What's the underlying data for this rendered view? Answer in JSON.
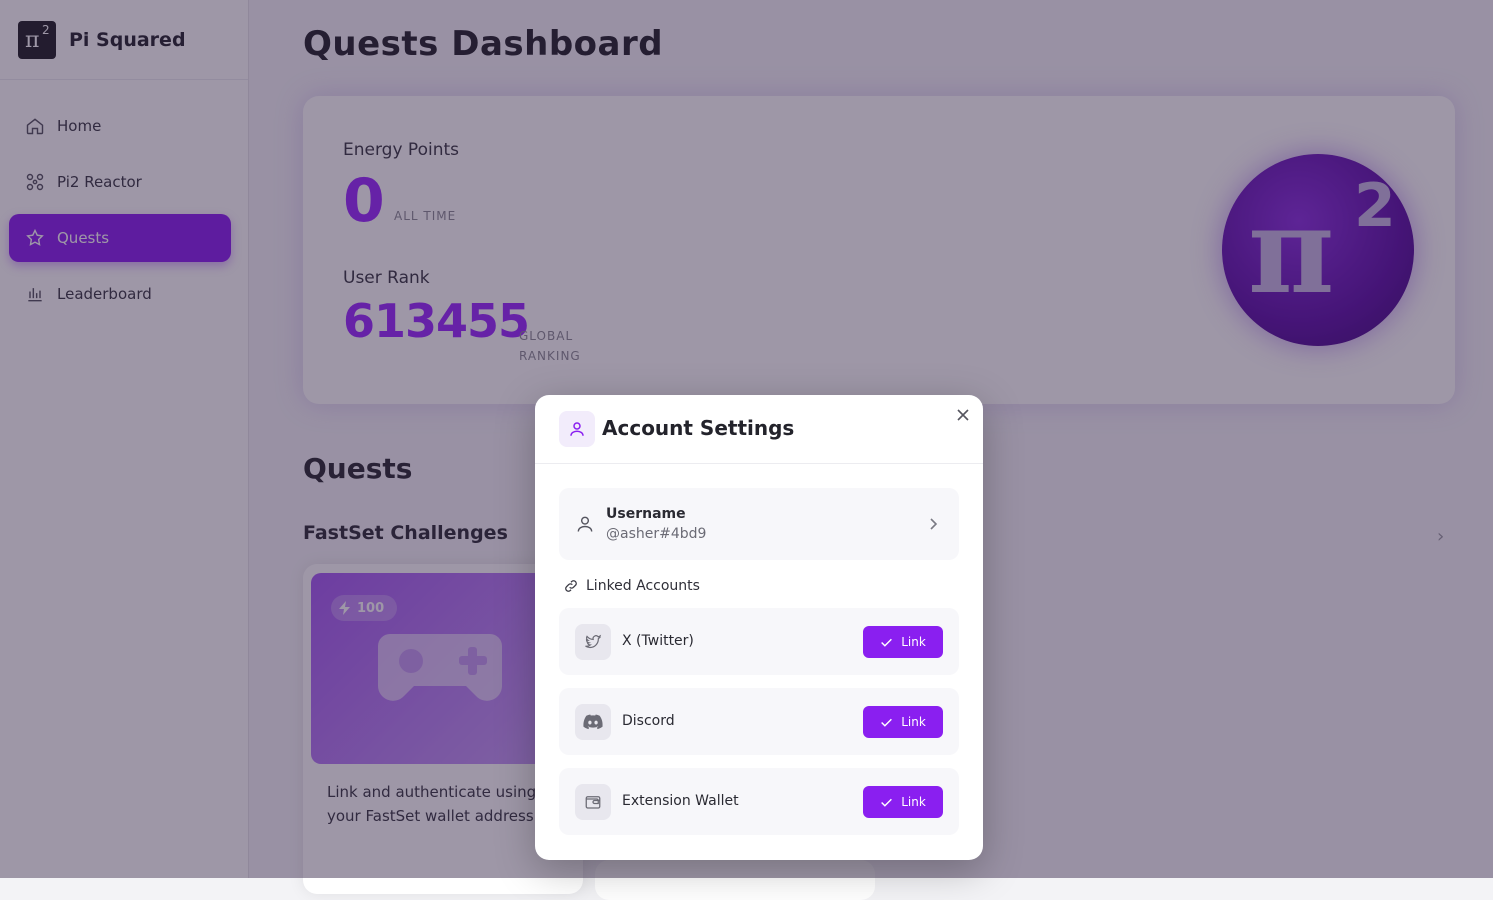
{
  "brand": {
    "name": "Pi Squared",
    "logo_symbol": "π",
    "logo_exponent": "2"
  },
  "sidebar": {
    "items": [
      {
        "label": "Home",
        "icon": "home-icon",
        "active": false
      },
      {
        "label": "Pi2 Reactor",
        "icon": "reactor-icon",
        "active": false
      },
      {
        "label": "Quests",
        "icon": "star-icon",
        "active": true
      },
      {
        "label": "Leaderboard",
        "icon": "bar-chart-icon",
        "active": false
      }
    ]
  },
  "main": {
    "title": "Quests Dashboard",
    "stats": {
      "energy_label": "Energy Points",
      "energy_value": "0",
      "energy_sub": "ALL TIME",
      "rank_label": "User Rank",
      "rank_value": "613455",
      "rank_sub": "GLOBAL RANKING"
    },
    "coin": {
      "symbol": "π",
      "exponent": "2"
    },
    "quests_title": "Quests",
    "challenges_title": "FastSet Challenges",
    "quest_card": {
      "points": "100",
      "description": "Link and authenticate using your FastSet wallet address"
    }
  },
  "modal": {
    "title": "Account Settings",
    "username_label": "Username",
    "username_value": "@asher#4bd9",
    "linked_header": "Linked Accounts",
    "accounts": [
      {
        "name": "X (Twitter)",
        "icon": "twitter-icon",
        "button": "Link"
      },
      {
        "name": "Discord",
        "icon": "discord-icon",
        "button": "Link"
      },
      {
        "name": "Extension Wallet",
        "icon": "wallet-icon",
        "button": "Link"
      }
    ]
  },
  "colors": {
    "accent": "#8a1ff0",
    "value_purple": "#9a2bff"
  }
}
